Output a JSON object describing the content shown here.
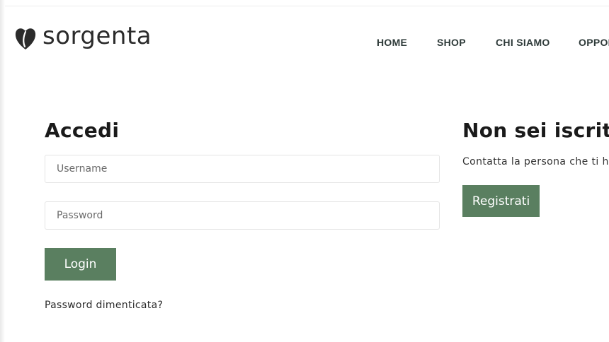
{
  "header": {
    "logo_text": "sorgenta",
    "nav": {
      "home": "HOME",
      "shop": "SHOP",
      "chi_siamo": "CHI SIAMO",
      "opportunita": "OPPOR"
    }
  },
  "login": {
    "title": "Accedi",
    "username_placeholder": "Username",
    "password_placeholder": "Password",
    "button_label": "Login",
    "forgot_link": "Password dimenticata?"
  },
  "register": {
    "title": "Non sei iscritt",
    "text": "Contatta la persona che ti h",
    "button_label": "Registrati"
  },
  "colors": {
    "button_bg": "#5a7f60",
    "nav_text": "#2f3b3a",
    "logo_mark": "#2b2b2b"
  },
  "icons": {
    "logo": "heart-leaf-icon"
  }
}
